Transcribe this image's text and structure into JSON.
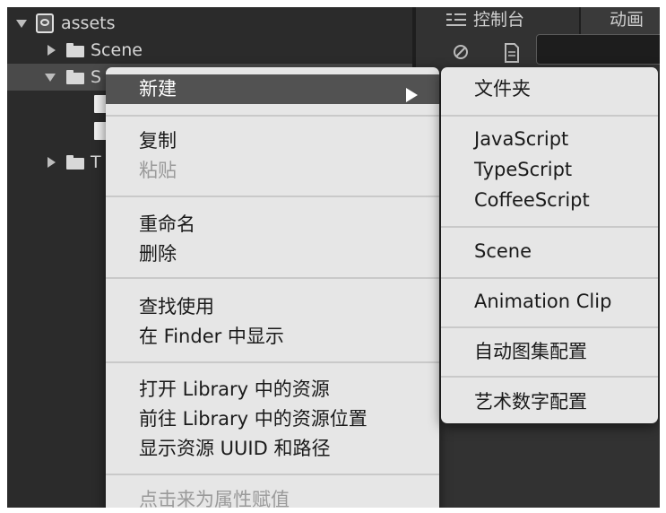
{
  "assets_panel": {
    "root_label": "assets",
    "rows": [
      {
        "label": "Scene"
      },
      {
        "label": "S"
      },
      {
        "label": "T"
      }
    ]
  },
  "console_panel": {
    "tab_console": "控制台",
    "tab_animation": "动画",
    "console_tab_icon": "list-icon",
    "clear_icon": "no-entry-icon",
    "doc_icon": "document-icon"
  },
  "context_menu": {
    "items": {
      "new": "新建",
      "copy": "复制",
      "paste": "粘贴",
      "rename": "重命名",
      "delete": "删除",
      "find_usage": "查找使用",
      "show_in_finder": "在 Finder 中显示",
      "open_in_library": "打开 Library 中的资源",
      "go_to_library": "前往 Library 中的资源位置",
      "show_uuid": "显示资源 UUID 和路径",
      "assign_property": "点击来为属性赋值"
    }
  },
  "submenu": {
    "items": {
      "folder": "文件夹",
      "javascript": "JavaScript",
      "typescript": "TypeScript",
      "coffeescript": "CoffeeScript",
      "scene": "Scene",
      "animation_clip": "Animation Clip",
      "auto_atlas": "自动图集配置",
      "art_number": "艺术数字配置"
    }
  },
  "colors": {
    "panel_bg": "#2b2b2b",
    "menu_bg": "#e6e6e6",
    "menu_highlight": "#525252",
    "disabled_text": "#9a9a9a"
  }
}
